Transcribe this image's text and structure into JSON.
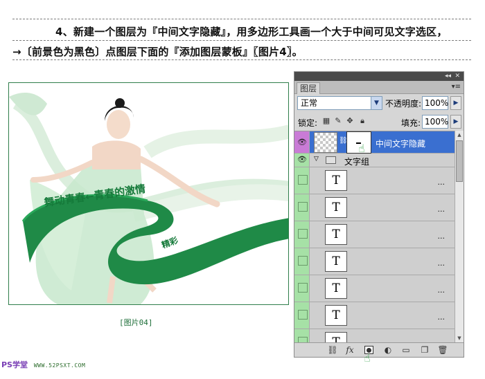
{
  "instructions": {
    "line1": "4、新建一个图层为『中间文字隐藏』，用多边形工具画一个大于中间可见文字选区，",
    "line2": "→〔前景色为黑色〕点图层下面的『添加图层蒙板』〖图片4〗。"
  },
  "figure": {
    "overlay_text": "舞动青春←青春的激情",
    "overlay_text_small": "精彩",
    "caption": "[图片04]"
  },
  "layers_panel": {
    "tab_label": "图层",
    "blend_mode": "正常",
    "opacity_label": "不透明度:",
    "opacity_value": "100%",
    "lock_label": "锁定:",
    "fill_label": "填充:",
    "fill_value": "100%",
    "layers": [
      {
        "name": "中间文字隐藏",
        "selected": true,
        "type": "pixel-with-mask"
      },
      {
        "name": "文字组",
        "selected": false,
        "type": "group"
      },
      {
        "name": "...",
        "type": "text"
      },
      {
        "name": "...",
        "type": "text"
      },
      {
        "name": "...",
        "type": "text"
      },
      {
        "name": "...",
        "type": "text"
      },
      {
        "name": "...",
        "type": "text"
      },
      {
        "name": "...",
        "type": "text"
      }
    ],
    "text_layer_glyph": "T",
    "bottom_icons": [
      "link-icon",
      "fx-icon",
      "add-mask-icon",
      "adjustment-icon",
      "folder-icon",
      "new-layer-icon",
      "trash-icon"
    ]
  },
  "footer": {
    "site_logo": "PS学堂",
    "site_url": "WWW.52PSXT.COM"
  },
  "colors": {
    "selected_row": "#3a6fd0",
    "eye_column": "#a6e1a6",
    "ribbon_green": "#1f8a47"
  }
}
